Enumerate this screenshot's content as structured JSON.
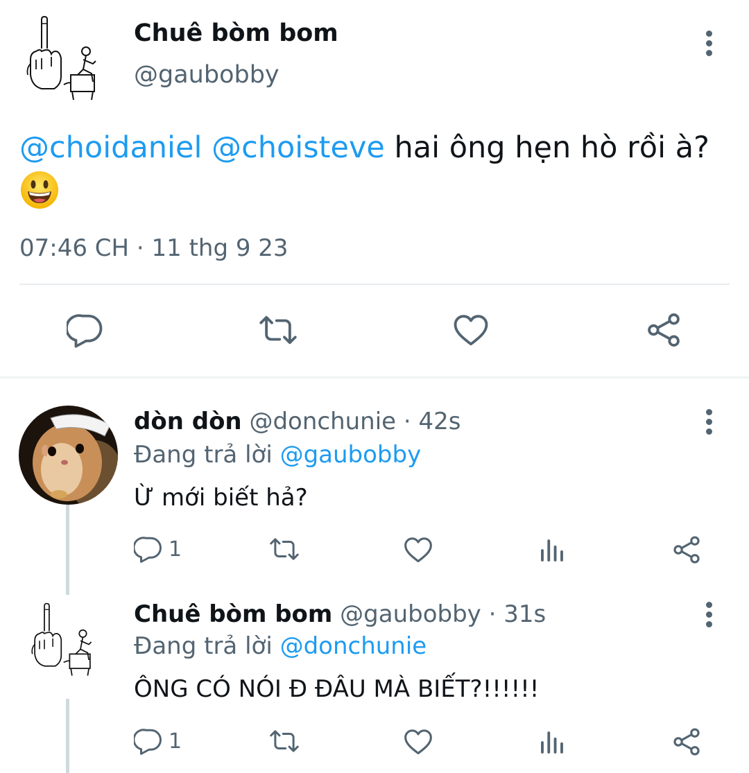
{
  "main_tweet": {
    "author_name": "Chuê bòm bom",
    "author_handle": "@gaubobby",
    "mention_1": "@choidaniel",
    "mention_2": "@choisteve",
    "text": " hai ông hẹn hò rồi à?",
    "timestamp": "07:46 CH · 11 thg 9 23"
  },
  "replies": [
    {
      "author_name": "dòn dòn",
      "author_handle": "@donchunie",
      "time": " · 42s",
      "replying_prefix": "Đang trả lời ",
      "replying_to": "@gaubobby",
      "text": "Ừ mới biết hả?",
      "reply_count": "1"
    },
    {
      "author_name": "Chuê bòm bom",
      "author_handle": "@gaubobby",
      "time": " · 31s",
      "replying_prefix": "Đang trả lời ",
      "replying_to": "@donchunie",
      "text": "ÔNG CÓ NÓI Đ ĐÂU MÀ BIẾT?!!!!!!",
      "reply_count": "1"
    }
  ],
  "colors": {
    "accent": "#1d9bf0",
    "text": "#0f1419",
    "secondary": "#536471",
    "divider": "#e7ebee"
  },
  "icons": [
    "reply-icon",
    "retweet-icon",
    "like-icon",
    "share-icon",
    "views-icon",
    "more-icon",
    "smiley-emoji"
  ]
}
